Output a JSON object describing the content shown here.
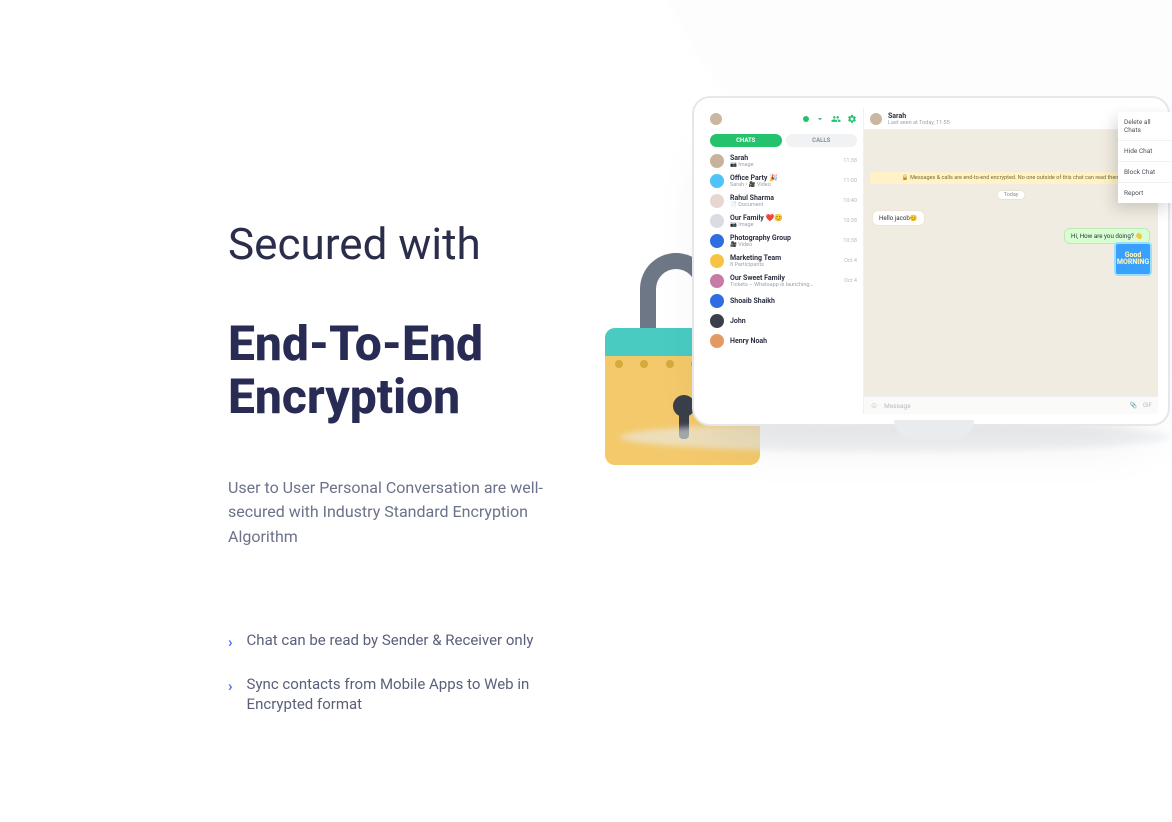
{
  "marketing": {
    "headline_light": "Secured with",
    "headline_bold_line1": "End-To-End",
    "headline_bold_line2": "Encryption",
    "subtext": "User to User Personal Conversation are well-secured with Industry Standard Encryption Algorithm",
    "features": [
      "Chat can be read by Sender & Receiver only",
      "Sync contacts from Mobile Apps to Web in Encrypted format"
    ]
  },
  "app": {
    "tabs": {
      "chats": "CHATS",
      "calls": "CALLS"
    },
    "conversations": [
      {
        "name": "Sarah",
        "sub": "📷 Image",
        "time": "11:38",
        "color": "#c8b29a"
      },
      {
        "name": "Office Party 🎉",
        "sub": "Sarah • 🎥 Video",
        "time": "11:00",
        "color": "#4fc3f7"
      },
      {
        "name": "Rahul Sharma",
        "sub": "📄 Document",
        "time": "10:40",
        "color": "#e6d8d1"
      },
      {
        "name": "Our Family ❤️😊",
        "sub": "📷 Image",
        "time": "10:38",
        "color": "#d9dde1"
      },
      {
        "name": "Photography Group",
        "sub": "🎥 Video",
        "time": "10:38",
        "color": "#2f6ee0"
      },
      {
        "name": "Marketing Team",
        "sub": "8 Participants",
        "time": "Oct 4",
        "color": "#f6c445"
      },
      {
        "name": "Our Sweet Family",
        "sub": "Tickets – Whatsapp is launching…",
        "time": "Oct 4",
        "color": "#c67ca4"
      },
      {
        "name": "Shoaib Shaikh",
        "sub": "",
        "time": "",
        "color": "#2f6ee0"
      },
      {
        "name": "John",
        "sub": "",
        "time": "",
        "color": "#3b3f4a"
      },
      {
        "name": "Henry Noah",
        "sub": "",
        "time": "",
        "color": "#e39a62"
      }
    ],
    "chat_header": {
      "name": "Sarah",
      "status": "Last seen at Today, 11:55"
    },
    "encryption_banner": "🔒 Messages & calls are end-to-end encrypted. No one outside of this chat can read them",
    "date_badge": "Today",
    "msg_in": "Hello jacob😊",
    "msg_out": "Hi, How are you doing? 👋",
    "sticker_text": "Good MORNING",
    "composer": {
      "placeholder": "Message",
      "attach": "📎",
      "gif": "GIF"
    },
    "context_menu": [
      "Delete all Chats",
      "Hide Chat",
      "Block Chat",
      "Report"
    ]
  }
}
